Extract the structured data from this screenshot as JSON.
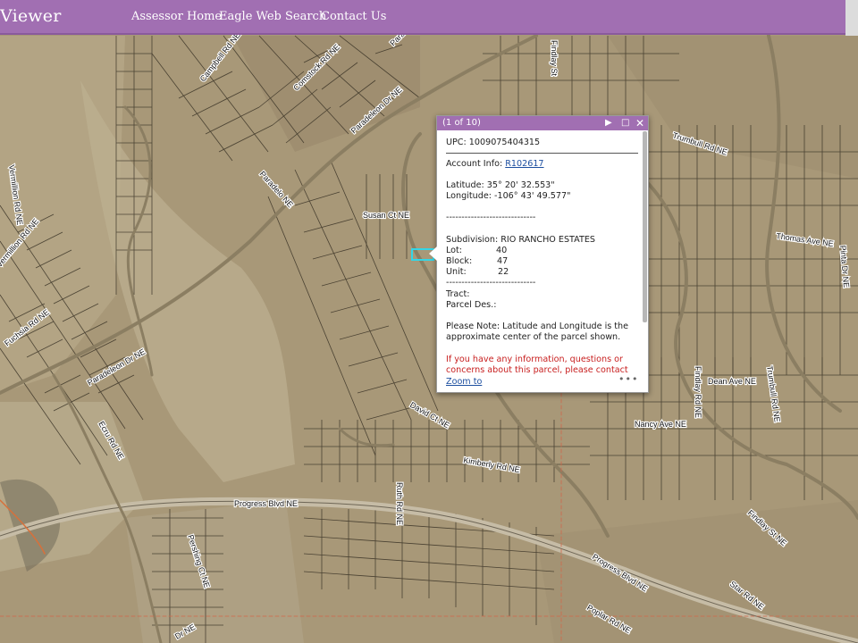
{
  "header": {
    "app_title": "Viewer",
    "nav": [
      "Assessor Home",
      "Eagle Web Search",
      "Contact Us"
    ]
  },
  "map": {
    "streets": [
      "Campbell Rd NE",
      "Comstock Rd NE",
      "Paradeleon Dr NE",
      "Paradeleon Dr NE",
      "Paradelo NE",
      "Vermillion Rd NE",
      "Vermillion Rd NE",
      "Susan Ct NE",
      "Fuchsia Rd NE",
      "Paradeleon Dr NE",
      "Ecru Rd NE",
      "David Ct NE",
      "Kimberly Rd NE",
      "Progress Blvd NE",
      "Ruth Rd NE",
      "Pershing Ct NE",
      "Findlay St",
      "Trumbull Rd NE",
      "Thomas Ave NE",
      "Pinta Dr NE",
      "Dean Ave NE",
      "Trumbull Rd NE",
      "Nancy Ave NE",
      "Findlay Rd NE",
      "Findlay St NE",
      "Progress Blvd NE",
      "Star Rd NE",
      "Poplar Rd NE",
      "Dr NE"
    ]
  },
  "popup": {
    "count": "(1 of 10)",
    "upc": "UPC: 1009075404315",
    "account_label": "Account Info: ",
    "account_link": "R102617",
    "latitude": "Latitude: 35° 20' 32.553\"",
    "longitude": "Longitude: -106° 43' 49.577\"",
    "separator": "-----------------------------",
    "subdivision": "Subdivision: RIO RANCHO ESTATES",
    "lot_label": "Lot:",
    "lot": "40",
    "block_label": "Block:",
    "block": "47",
    "unit_label": "Unit:",
    "unit": "22",
    "tract": "Tract:",
    "parcel_des": "Parcel Des.:",
    "note_1": "Please Note: Latitude and Longitude is the",
    "note_2": "approximate center of the parcel shown.",
    "warn_1": "If you have any information, questions or",
    "warn_2": "concerns about this parcel, please contact",
    "zoom": "Zoom to",
    "more": "•••"
  },
  "colors": {
    "header": "#a16fb2",
    "ground": "#a89878",
    "lot_lines": "#3a3326",
    "parcel_outline": "#33d6e6",
    "warning": "#c82020",
    "link": "#1d4fa0"
  }
}
